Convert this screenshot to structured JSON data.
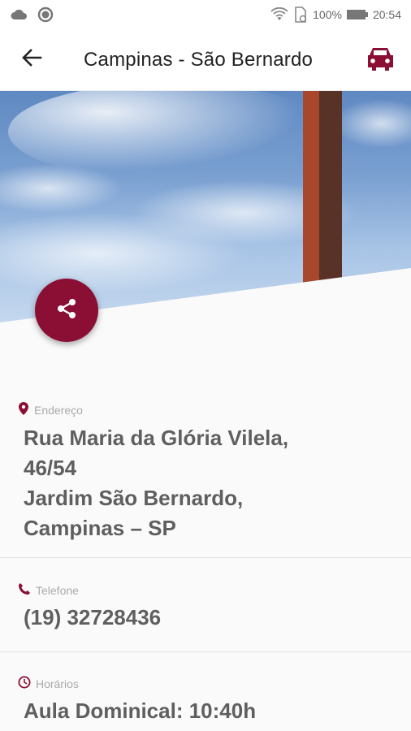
{
  "status_bar": {
    "battery": "100%",
    "time": "20:54"
  },
  "app_bar": {
    "title": "Campinas - São Bernardo",
    "back_icon": "arrow-back-icon",
    "car_icon": "car-icon"
  },
  "share_button": {
    "icon": "share-icon"
  },
  "address": {
    "label": "Endereço",
    "lines": [
      "Rua Maria da Glória Vilela,",
      "46/54",
      "Jardim São Bernardo,",
      "Campinas – SP"
    ]
  },
  "phone": {
    "label": "Telefone",
    "value": "(19) 32728436"
  },
  "hours": {
    "label": "Horários",
    "first": "Aula Dominical: 10:40h"
  },
  "colors": {
    "accent": "#8b0f35"
  }
}
